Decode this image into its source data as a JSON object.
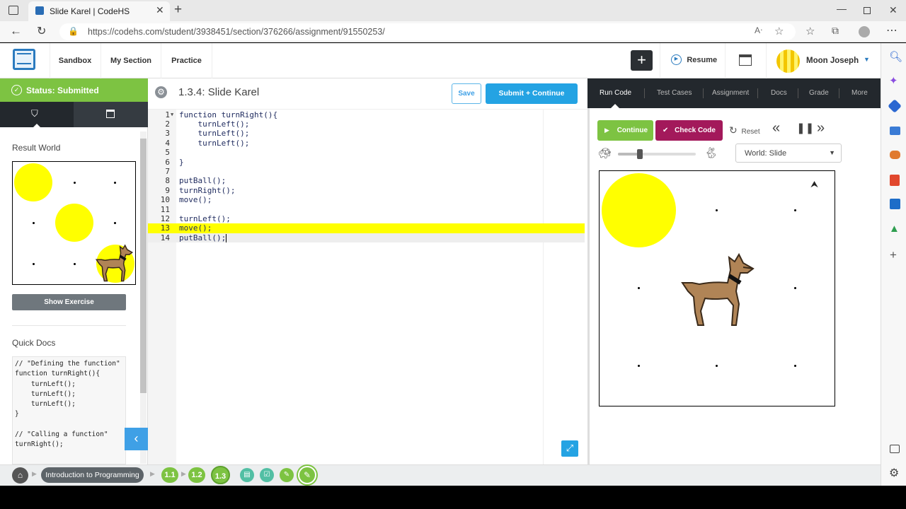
{
  "browser": {
    "tab_title": "Slide Karel | CodeHS",
    "url": "https://codehs.com/student/3938451/section/376266/assignment/91550253/"
  },
  "header": {
    "nav": [
      "Sandbox",
      "My Section",
      "Practice"
    ],
    "resume_label": "Resume",
    "user_name": "Moon Joseph"
  },
  "left": {
    "status": "Status: Submitted",
    "result_world_title": "Result World",
    "show_exercise": "Show Exercise",
    "quick_docs_title": "Quick Docs",
    "quick_docs_lines": [
      "// \"Defining the function\"",
      "function turnRight(){",
      "    turnLeft();",
      "    turnLeft();",
      "    turnLeft();",
      "}",
      "",
      "// \"Calling a function\"",
      "turnRight();"
    ]
  },
  "editor": {
    "title": "1.3.4: Slide Karel",
    "save_label": "Save",
    "submit_label": "Submit + Continue",
    "highlighted_line": 13,
    "active_line": 14,
    "lines": [
      "function turnRight(){",
      "    turnLeft();",
      "    turnLeft();",
      "    turnLeft();",
      "",
      "}",
      "",
      "putBall();",
      "turnRight();",
      "move();",
      "",
      "turnLeft();",
      "move();",
      "putBall();"
    ]
  },
  "right": {
    "tabs": [
      "Run Code",
      "Test Cases",
      "Assignment",
      "Docs",
      "Grade",
      "More"
    ],
    "active_tab": "Run Code",
    "continue_label": "Continue",
    "check_code_label": "Check Code",
    "reset_label": "Reset",
    "world_select": "World: Slide",
    "speed": 0.28
  },
  "bottom": {
    "course": "Introduction to Programming",
    "units": [
      "1.1",
      "1.2",
      "1.3"
    ]
  },
  "colors": {
    "green": "#7dc342",
    "blue_button": "#24a3e3",
    "check_code": "#a3195b",
    "dark": "#23282d",
    "ball": "#ffff00",
    "highlight": "#ffff00"
  }
}
